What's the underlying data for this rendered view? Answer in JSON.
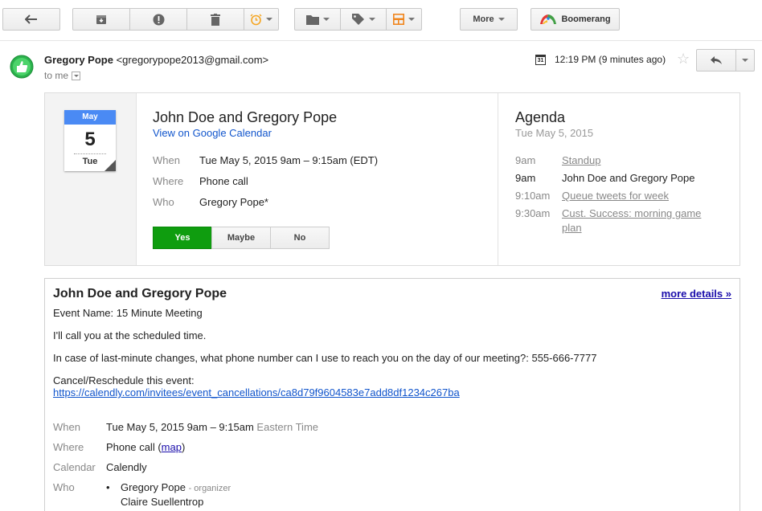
{
  "toolbar": {
    "more_label": "More",
    "boomerang_label": "Boomerang"
  },
  "header": {
    "sender_name": "Gregory Pope",
    "sender_email": "<gregorypope2013@gmail.com>",
    "to_label": "to me",
    "calendar_icon_day": "31",
    "time": "12:19 PM (9 minutes ago)"
  },
  "calendar_card": {
    "month": "May",
    "day": "5",
    "weekday": "Tue",
    "title": "John Doe and Gregory Pope",
    "view_link": "View on Google Calendar",
    "fields": [
      {
        "label": "When",
        "value": "Tue May 5, 2015 9am – 9:15am (EDT)"
      },
      {
        "label": "Where",
        "value": "Phone call"
      },
      {
        "label": "Who",
        "value": "Gregory Pope*"
      }
    ],
    "rsvp": [
      "Yes",
      "Maybe",
      "No"
    ],
    "agenda": {
      "title": "Agenda",
      "date": "Tue May 5, 2015",
      "items": [
        {
          "time": "9am",
          "label": "Standup",
          "link": true
        },
        {
          "time": "9am",
          "label": "John Doe and Gregory Pope",
          "link": false
        },
        {
          "time": "9:10am",
          "label": "Queue tweets for week",
          "link": true
        },
        {
          "time": "9:30am",
          "label": "Cust. Success: morning game",
          "label2": "plan",
          "link": true
        }
      ]
    }
  },
  "body": {
    "title": "John Doe and Gregory Pope",
    "more_details": "more details »",
    "event_name": "Event Name: 15 Minute Meeting",
    "line1": "I'll call you at the scheduled time.",
    "line2": "In case of last-minute changes, what phone number can I use to reach you on the day of our meeting?: 555-666-7777",
    "cancel_label": "Cancel/Reschedule this event:",
    "cancel_url": "https://calendly.com/invitees/event_cancellations/ca8d79f9604583e7add8df1234c267ba",
    "when_label": "When",
    "when_value": "Tue May 5, 2015 9am – 9:15am",
    "when_tz": "Eastern Time",
    "where_label": "Where",
    "where_value": "Phone call (",
    "where_map": "map",
    "where_close": ")",
    "calendar_label": "Calendar",
    "calendar_value": "Calendly",
    "who_label": "Who",
    "who_list": [
      {
        "name": "Gregory Pope",
        "role": "- organizer"
      },
      {
        "name": "Claire Suellentrop",
        "role": ""
      }
    ]
  }
}
